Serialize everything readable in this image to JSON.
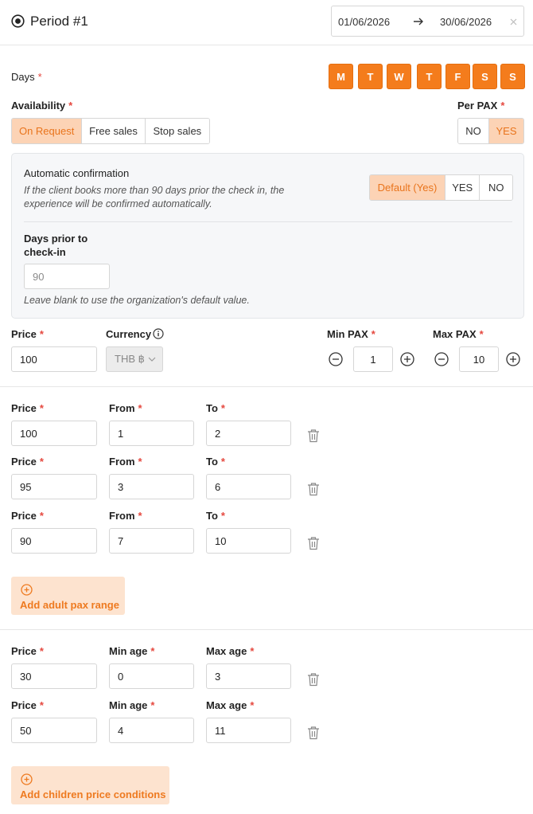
{
  "period": {
    "title": "Period #1",
    "date_from": "01/06/2026",
    "date_to": "30/06/2026"
  },
  "days": {
    "label": "Days",
    "letters": [
      "M",
      "T",
      "W",
      "T",
      "F",
      "S",
      "S"
    ]
  },
  "availability": {
    "label": "Availability",
    "options": [
      "On Request",
      "Free sales",
      "Stop sales"
    ],
    "selected": "On Request"
  },
  "per_pax": {
    "label": "Per PAX",
    "options": [
      "NO",
      "YES"
    ],
    "selected": "YES"
  },
  "auto_confirm": {
    "title": "Automatic confirmation",
    "description": "If the client books more than 90 days prior the check in, the experience will be confirmed automatically.",
    "options": [
      "Default (Yes)",
      "YES",
      "NO"
    ],
    "selected": "Default (Yes)",
    "days_prior_label_1": "Days prior to",
    "days_prior_label_2": "check-in",
    "days_prior_placeholder": "90",
    "hint": "Leave blank to use the organization's default value."
  },
  "base": {
    "price_label": "Price",
    "price": "100",
    "currency_label": "Currency",
    "currency": "THB ฿",
    "min_pax_label": "Min PAX",
    "min_pax": "1",
    "max_pax_label": "Max PAX",
    "max_pax": "10"
  },
  "pax_ranges": {
    "labels": {
      "price": "Price",
      "from": "From",
      "to": "To"
    },
    "rows": [
      {
        "price": "100",
        "from": "1",
        "to": "2"
      },
      {
        "price": "95",
        "from": "3",
        "to": "6"
      },
      {
        "price": "90",
        "from": "7",
        "to": "10"
      }
    ],
    "add_label": "Add adult pax range"
  },
  "children": {
    "labels": {
      "price": "Price",
      "min_age": "Min age",
      "max_age": "Max age"
    },
    "rows": [
      {
        "price": "30",
        "min_age": "0",
        "max_age": "3"
      },
      {
        "price": "50",
        "min_age": "4",
        "max_age": "11"
      }
    ],
    "add_label": "Add children price conditions"
  },
  "colors": {
    "accent": "#f47c1c",
    "accent_light": "#fcd3b5",
    "required": "#e5483f"
  }
}
